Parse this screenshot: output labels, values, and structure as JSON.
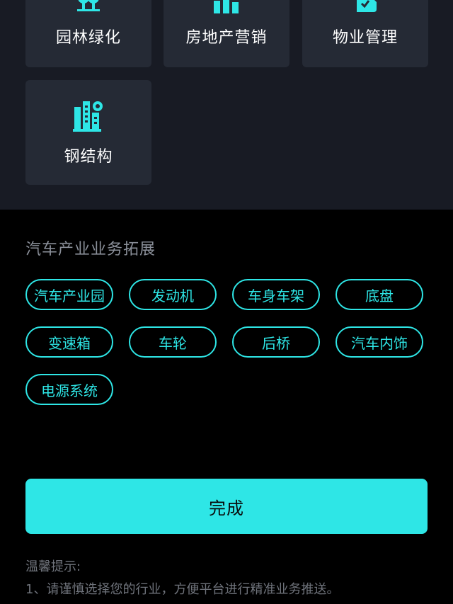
{
  "colors": {
    "accent": "#2ee6e6",
    "card_bg": "#252a35",
    "grid_bg": "#181b24",
    "page_bg": "#000000"
  },
  "industries": [
    {
      "label": "园林绿化",
      "icon": "trees-icon"
    },
    {
      "label": "房地产营销",
      "icon": "bar-chart-icon"
    },
    {
      "label": "物业管理",
      "icon": "document-icon"
    },
    {
      "label": "钢结构",
      "icon": "building-gear-icon"
    }
  ],
  "auto_section": {
    "title": "汽车产业业务拓展",
    "tags": [
      "汽车产业园",
      "发动机",
      "车身车架",
      "底盘",
      "变速箱",
      "车轮",
      "后桥",
      "汽车内饰",
      "电源系统"
    ]
  },
  "done_button": {
    "label": "完成"
  },
  "tips": {
    "title": "温馨提示:",
    "line1": "1、请谨慎选择您的行业，方便平台进行精准业务推送。"
  }
}
